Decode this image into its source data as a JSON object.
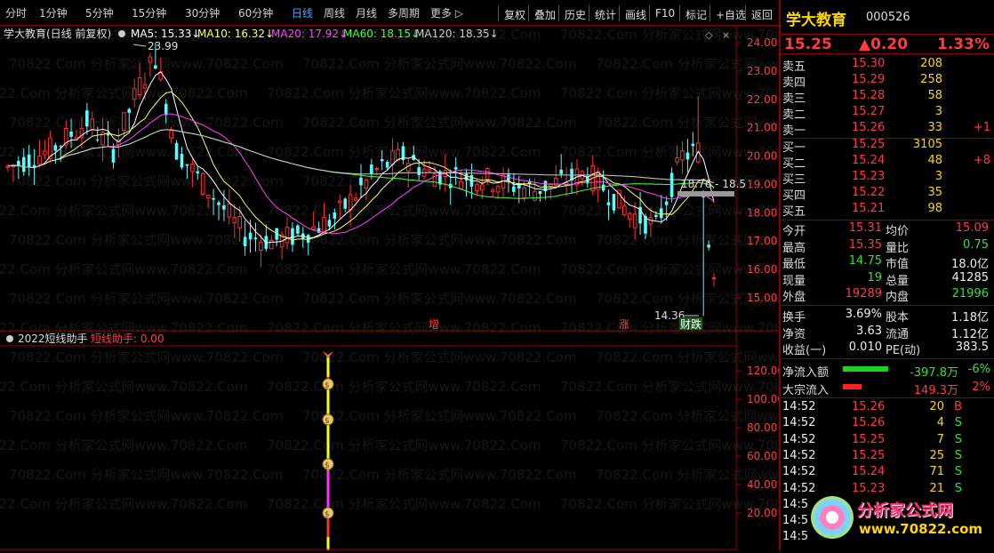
{
  "toolbar": {
    "periods": [
      "分时",
      "1分钟",
      "5分钟",
      "15分钟",
      "30分钟",
      "60分钟",
      "日线",
      "周线",
      "月线",
      "多周期",
      "更多"
    ],
    "active_period": "日线",
    "buttons": [
      "复权",
      "叠加",
      "历史",
      "统计",
      "画线",
      "F10",
      "标记",
      "+自选",
      "返回"
    ]
  },
  "main_chart": {
    "title": "学大教育(日线 前复权)",
    "ma": [
      {
        "label": "MA5: 15.33↓",
        "color": "#ffffff"
      },
      {
        "label": "MA10: 16.32↓",
        "color": "#ffff66"
      },
      {
        "label": "MA20: 17.92↓",
        "color": "#ff44ff"
      },
      {
        "label": "MA60: 18.15↓",
        "color": "#44ff44"
      },
      {
        "label": "MA120: 18.35↓",
        "color": "#cccccc"
      }
    ],
    "y_ticks": [
      "24.00",
      "23.00",
      "22.00",
      "21.00",
      "20.00",
      "19.00",
      "18.00",
      "17.00",
      "16.00",
      "15.00"
    ],
    "high_label": "23.99",
    "low_label": "14.36",
    "range_label": "18.76 - 18.5",
    "markers": [
      "增",
      "涨",
      "财",
      "跌"
    ]
  },
  "indicator": {
    "title": "2022短线助手",
    "name": "短线助手: 0.00",
    "y_ticks": [
      "120.00",
      "100.00",
      "80.00",
      "60.00",
      "40.00",
      "20.00"
    ]
  },
  "watermark": "70822.Com 分析家公式网www.70822.Com",
  "quote": {
    "name": "学大教育",
    "code": "000526",
    "price": "15.25",
    "change": "▲0.20",
    "change_pct": "1.33%",
    "asks": [
      {
        "label": "卖五",
        "price": "15.30",
        "vol": "208",
        "delta": ""
      },
      {
        "label": "卖四",
        "price": "15.29",
        "vol": "258",
        "delta": ""
      },
      {
        "label": "卖三",
        "price": "15.28",
        "vol": "58",
        "delta": ""
      },
      {
        "label": "卖二",
        "price": "15.27",
        "vol": "3",
        "delta": ""
      },
      {
        "label": "卖一",
        "price": "15.26",
        "vol": "33",
        "delta": "+1"
      }
    ],
    "bids": [
      {
        "label": "买一",
        "price": "15.25",
        "vol": "3105",
        "delta": ""
      },
      {
        "label": "买二",
        "price": "15.24",
        "vol": "48",
        "delta": "+8"
      },
      {
        "label": "买三",
        "price": "15.23",
        "vol": "3",
        "delta": ""
      },
      {
        "label": "买四",
        "price": "15.22",
        "vol": "35",
        "delta": ""
      },
      {
        "label": "买五",
        "price": "15.21",
        "vol": "98",
        "delta": ""
      }
    ],
    "stats": [
      {
        "l1": "今开",
        "v1": "15.31",
        "c1": "red",
        "l2": "均价",
        "v2": "15.09",
        "c2": "red"
      },
      {
        "l1": "最高",
        "v1": "15.35",
        "c1": "red",
        "l2": "量比",
        "v2": "0.75",
        "c2": "grn"
      },
      {
        "l1": "最低",
        "v1": "14.75",
        "c1": "grn",
        "l2": "市值",
        "v2": "18.0亿",
        "c2": "wht"
      },
      {
        "l1": "现量",
        "v1": "19",
        "c1": "grn",
        "l2": "总量",
        "v2": "41285",
        "c2": "wht"
      },
      {
        "l1": "外盘",
        "v1": "19289",
        "c1": "red",
        "l2": "内盘",
        "v2": "21996",
        "c2": "grn"
      }
    ],
    "stats2": [
      {
        "l1": "换手",
        "v1": "3.69%",
        "c1": "wht",
        "l2": "股本",
        "v2": "1.18亿",
        "c2": "wht"
      },
      {
        "l1": "净资",
        "v1": "3.63",
        "c1": "wht",
        "l2": "流通",
        "v2": "1.12亿",
        "c2": "wht"
      },
      {
        "l1": "收益(一)",
        "v1": "0.010",
        "c1": "wht",
        "l2": "PE(动)",
        "v2": "383.5",
        "c2": "wht"
      }
    ],
    "flows": [
      {
        "label": "净流入额",
        "bar_color": "#1fd11f",
        "value": "-397.8万",
        "pct": "-6%",
        "vc": "grn",
        "bar_fraction": 0.85
      },
      {
        "label": "大宗流入",
        "bar_color": "#ff2020",
        "value": "149.3万",
        "pct": "2%",
        "vc": "red",
        "bar_fraction": 0.35
      }
    ],
    "ticks": [
      {
        "time": "14:52",
        "price": "15.26",
        "vol": "20",
        "bs": "B"
      },
      {
        "time": "14:52",
        "price": "15.26",
        "vol": "4",
        "bs": "S"
      },
      {
        "time": "14:52",
        "price": "15.25",
        "vol": "7",
        "bs": "S"
      },
      {
        "time": "14:52",
        "price": "15.25",
        "vol": "25",
        "bs": "S"
      },
      {
        "time": "14:52",
        "price": "15.24",
        "vol": "71",
        "bs": "S"
      },
      {
        "time": "14:52",
        "price": "15.23",
        "vol": "21",
        "bs": "S"
      },
      {
        "time": "14:5",
        "price": "",
        "vol": "",
        "bs": ""
      },
      {
        "time": "14:5",
        "price": "",
        "vol": "",
        "bs": ""
      },
      {
        "time": "14:5",
        "price": "",
        "vol": "",
        "bs": ""
      }
    ],
    "logo_text": "分析家公式网",
    "logo_url": "www.70822.com"
  }
}
